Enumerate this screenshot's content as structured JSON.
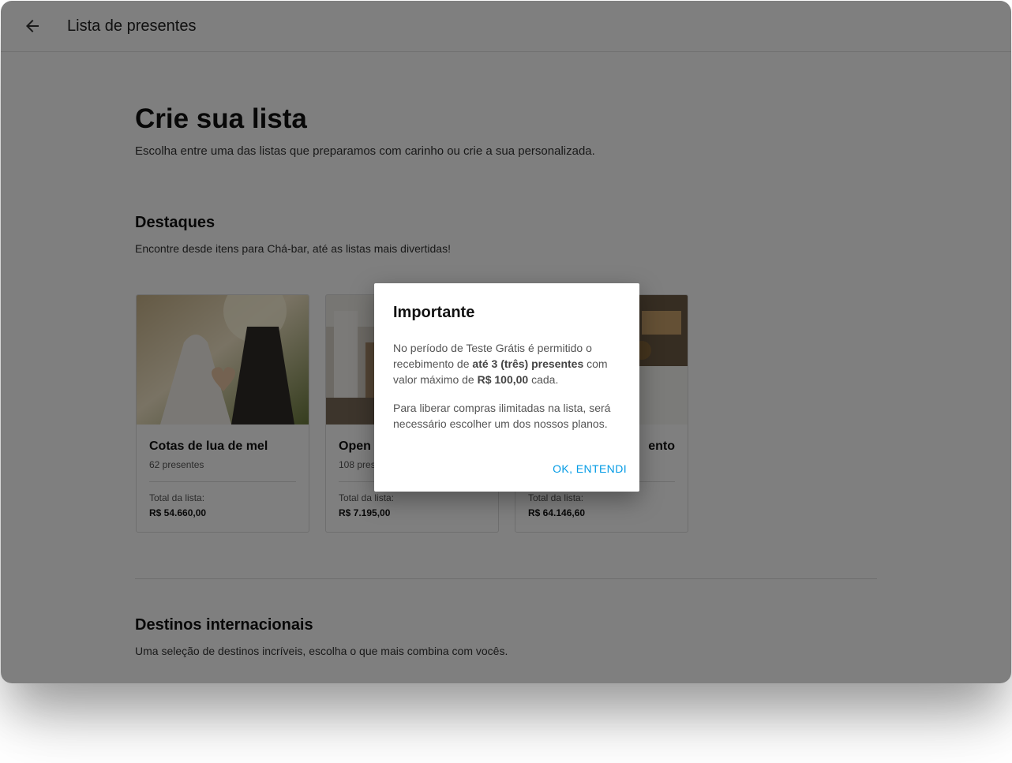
{
  "appbar": {
    "title": "Lista de presentes",
    "back_icon": "arrow-left-icon"
  },
  "hero": {
    "title": "Crie sua lista",
    "subtitle": "Escolha entre uma das listas que preparamos com carinho ou crie a sua personalizada."
  },
  "highlights": {
    "title": "Destaques",
    "subtitle": "Encontre desde itens para Chá-bar, até as listas mais divertidas!",
    "cards": [
      {
        "name": "Cotas de lua de mel",
        "count": "62 presentes",
        "total_label": "Total da lista:",
        "total_value": "R$ 54.660,00"
      },
      {
        "name": "Open H",
        "count": "108 pres",
        "total_label": "Total da lista:",
        "total_value": "R$ 7.195,00"
      },
      {
        "name": "ento",
        "count": "",
        "total_label": "Total da lista:",
        "total_value": "R$ 64.146,60"
      }
    ]
  },
  "international": {
    "title": "Destinos internacionais",
    "subtitle": "Uma seleção de destinos incríveis, escolha o que mais combina com vocês."
  },
  "dialog": {
    "title": "Importante",
    "p1_a": "No período de Teste Grátis é permitido o recebimento de ",
    "p1_b": "até 3 (três) presentes",
    "p1_c": " com valor máximo de ",
    "p1_d": "R$ 100,00",
    "p1_e": " cada.",
    "p2": "Para liberar compras ilimitadas na lista, será necessário escolher um dos nossos planos.",
    "ok_label": "OK, ENTENDI"
  },
  "colors": {
    "accent": "#039be5",
    "overlay": "rgba(0,0,0,0.5)"
  }
}
